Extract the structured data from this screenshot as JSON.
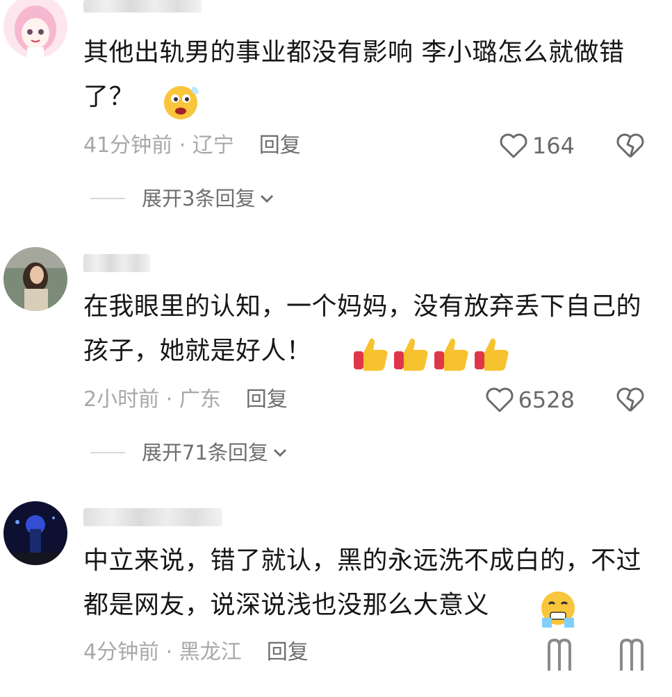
{
  "comments": [
    {
      "text": "其他出轨男的事业都没有影响 李小璐怎么就做错了？",
      "time": "41分钟前",
      "location": "辽宁",
      "reply_label": "回复",
      "likes": "164",
      "expand_label": "展开3条回复",
      "avatar_icon": "anime-girl-avatar"
    },
    {
      "text": "在我眼里的认知，一个妈妈，没有放弃丢下自己的孩子，她就是好人！",
      "time": "2小时前",
      "location": "广东",
      "reply_label": "回复",
      "likes": "6528",
      "expand_label": "展开71条回复",
      "avatar_icon": "woman-photo-avatar"
    },
    {
      "text": "中立来说，错了就认，黑的永远洗不成白的，不过都是网友，说深说浅也没那么大意义",
      "time": "4分钟前",
      "location": "黑龙江",
      "reply_label": "回复",
      "avatar_icon": "night-city-avatar"
    }
  ],
  "separator": " · ",
  "colors": {
    "meta": "#a8a8a8",
    "text": "#161616",
    "accent_thumb": "#f6c22e"
  }
}
